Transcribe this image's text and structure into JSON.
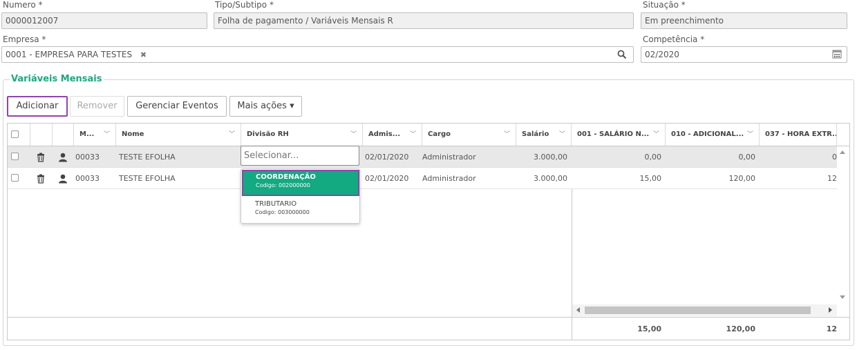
{
  "form": {
    "numero_label": "Numero *",
    "numero_value": "0000012007",
    "tipo_label": "Tipo/Subtipo *",
    "tipo_value": "Folha de pagamento / Variáveis Mensais R",
    "situacao_label": "Situação *",
    "situacao_value": "Em preenchimento",
    "empresa_label": "Empresa *",
    "empresa_value": "0001 - EMPRESA PARA TESTES",
    "empresa_clear": "✖",
    "competencia_label": "Competência *",
    "competencia_value": "02/2020"
  },
  "section": {
    "title": "Variáveis Mensais"
  },
  "toolbar": {
    "adicionar": "Adicionar",
    "remover": "Remover",
    "gerenciar": "Gerenciar Eventos",
    "mais": "Mais ações",
    "mais_caret": "▾"
  },
  "grid": {
    "columns": [
      "M...",
      "Nome",
      "Divisão RH",
      "Admis...",
      "Cargo",
      "Salário",
      "001 - SALÁRIO N...",
      "010 - ADICIONAL...",
      "037 - HORA EXTR..."
    ],
    "rows": [
      {
        "mat": "00033",
        "nome": "TESTE EFOLHA",
        "divisao": "",
        "admissao": "02/01/2020",
        "cargo": "Administrador",
        "salario": "3.000,00",
        "c001": "0,00",
        "c010": "0,00",
        "c037": "0"
      },
      {
        "mat": "00033",
        "nome": "TESTE EFOLHA",
        "divisao": "",
        "admissao": "02/01/2020",
        "cargo": "Administrador",
        "salario": "3.000,00",
        "c001": "15,00",
        "c010": "120,00",
        "c037": "12"
      }
    ],
    "totals": {
      "c001": "15,00",
      "c010": "120,00",
      "c037": "12"
    }
  },
  "dropdown": {
    "placeholder": "Selecionar...",
    "options": [
      {
        "title": "COORDENAÇÃO",
        "code": "Codigo: 002000000"
      },
      {
        "title": "TRIBUTARIO",
        "code": "Codigo: 003000000"
      }
    ]
  },
  "colors": {
    "accent": "#13a981",
    "highlight": "#8e44ad"
  }
}
